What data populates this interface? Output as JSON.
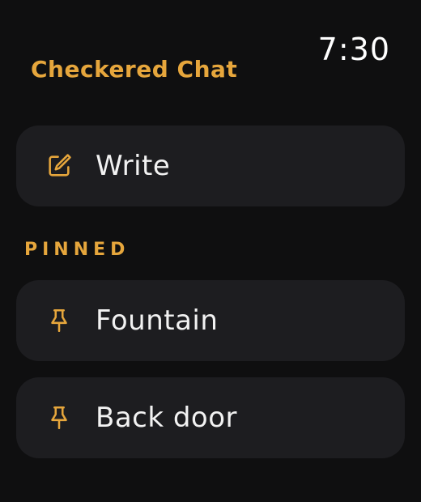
{
  "status": {
    "time": "7:30"
  },
  "app": {
    "title": "Checkered Chat"
  },
  "compose": {
    "label": "Write",
    "icon": "compose-icon"
  },
  "pinned": {
    "heading": "PINNED",
    "items": [
      {
        "label": "Fountain",
        "icon": "pin-icon"
      },
      {
        "label": "Back door",
        "icon": "pin-icon"
      }
    ]
  },
  "colors": {
    "background": "#0f0f10",
    "card": "#1d1d20",
    "accent": "#e6a63c",
    "text": "#f2f2f2"
  }
}
